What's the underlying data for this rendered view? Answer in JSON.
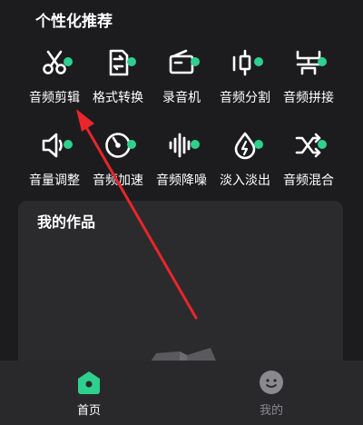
{
  "section": {
    "title": "个性化推荐"
  },
  "tools": [
    {
      "label": "音频剪辑",
      "icon": "scissors-icon"
    },
    {
      "label": "格式转换",
      "icon": "convert-doc-icon"
    },
    {
      "label": "录音机",
      "icon": "recorder-icon"
    },
    {
      "label": "音频分割",
      "icon": "split-icon"
    },
    {
      "label": "音频拼接",
      "icon": "merge-icon"
    },
    {
      "label": "音量调整",
      "icon": "volume-icon"
    },
    {
      "label": "音频加速",
      "icon": "speed-gauge-icon"
    },
    {
      "label": "音频降噪",
      "icon": "waveform-icon"
    },
    {
      "label": "淡入淡出",
      "icon": "fade-drop-icon"
    },
    {
      "label": "音频混合",
      "icon": "shuffle-icon"
    }
  ],
  "works": {
    "title": "我的作品"
  },
  "tabbar": {
    "home_label": "首页",
    "me_label": "我的"
  },
  "colors": {
    "accent": "#2fd08d",
    "arrow": "#e8262b",
    "background": "#1c1c1e"
  }
}
